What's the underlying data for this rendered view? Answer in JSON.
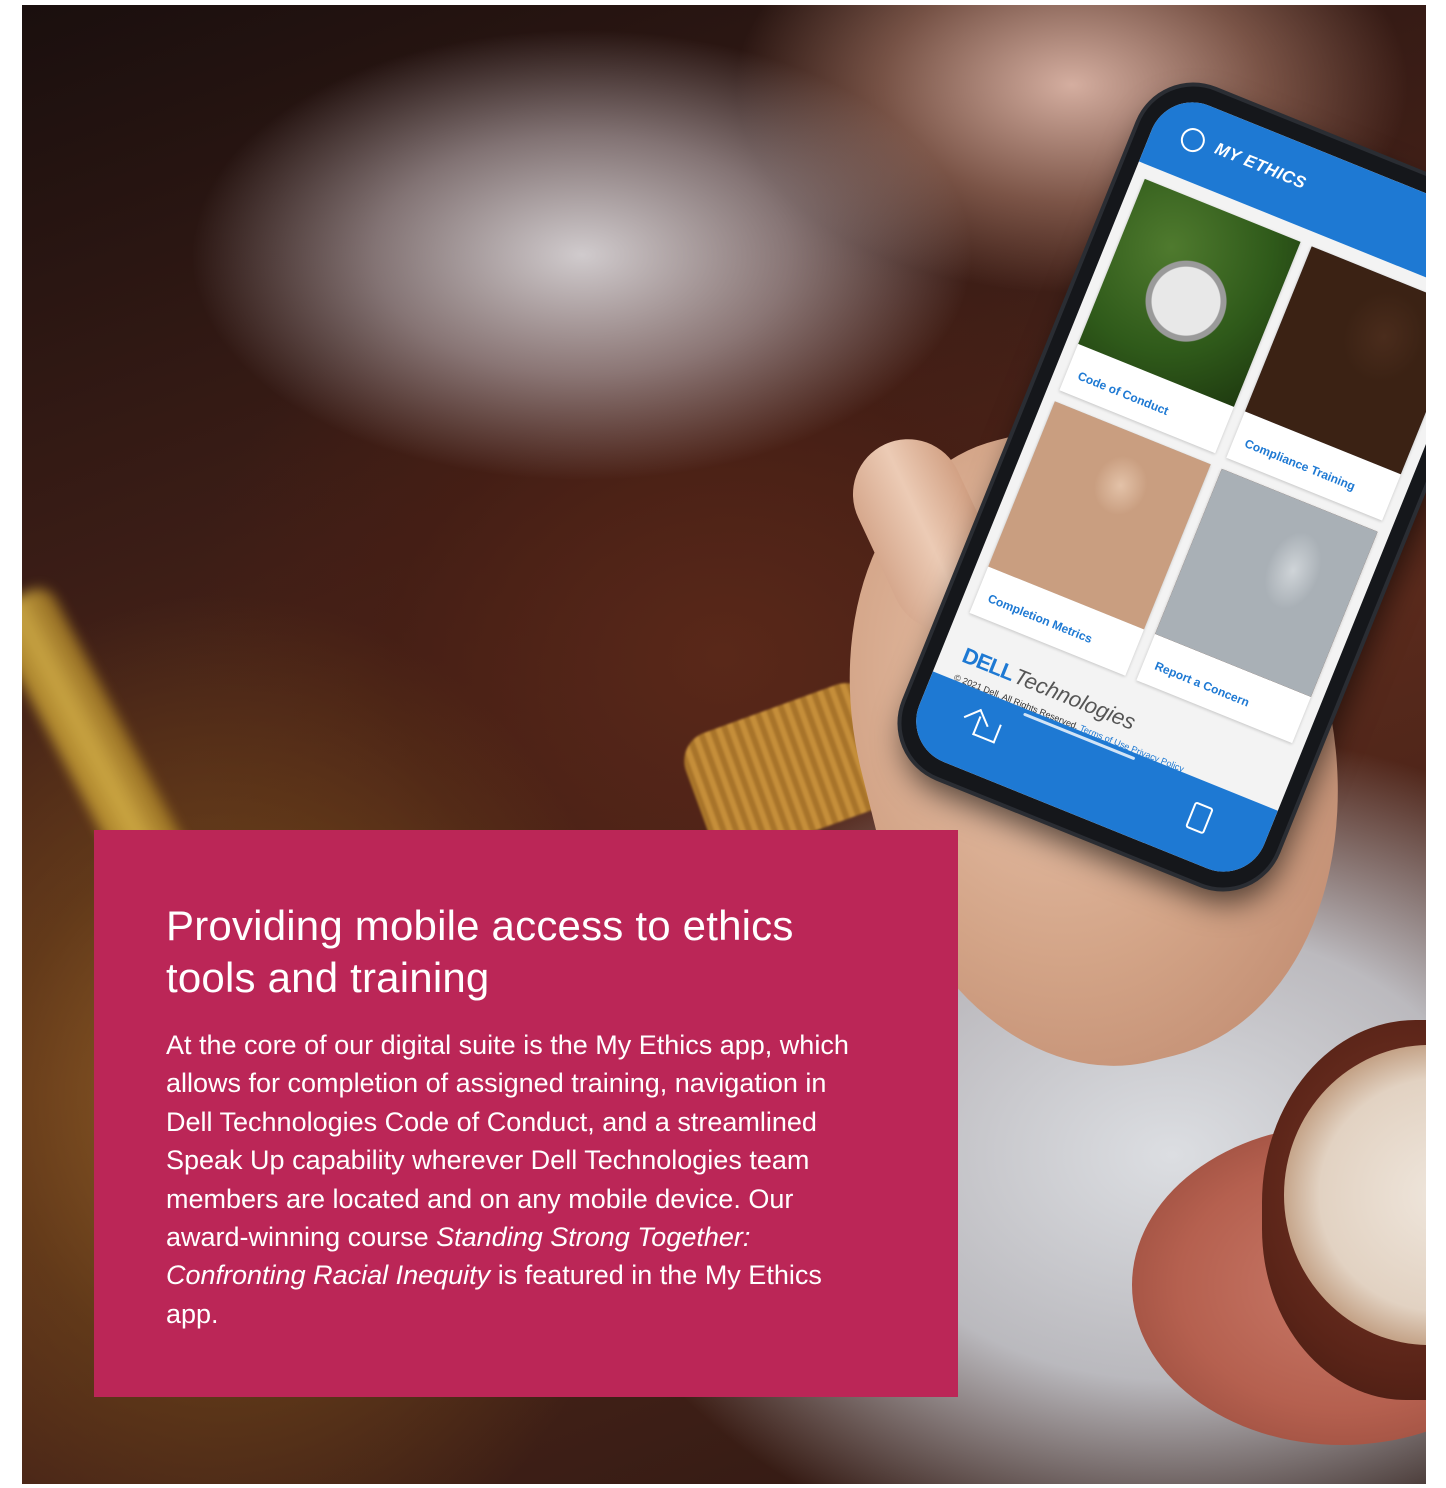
{
  "phone_app": {
    "title": "MY ETHICS",
    "tiles": [
      {
        "label": "Code of Conduct"
      },
      {
        "label": "Compliance Training"
      },
      {
        "label": "Completion Metrics"
      },
      {
        "label": "Report a Concern"
      }
    ],
    "brand_mark": "DELL",
    "brand_suffix": "Technologies",
    "copyright": "© 2021 Dell. All Rights Reserved.",
    "terms_link": "Terms of Use",
    "privacy_link": "Privacy Policy",
    "accent_color": "#1e79d3"
  },
  "card": {
    "heading": "Providing mobile access to ethics tools and training",
    "body_part1": "At the core of our digital suite is the My Ethics app, which allows for completion of assigned training, navigation in Dell Technologies Code of Conduct, and a streamlined Speak Up capability wherever Dell Technologies team members are located and on any mobile device. Our award-winning course ",
    "body_italic": "Standing Strong Together: Confronting Racial Inequity",
    "body_part2": " is featured in the My Ethics app.",
    "background_color": "#bb2657"
  }
}
